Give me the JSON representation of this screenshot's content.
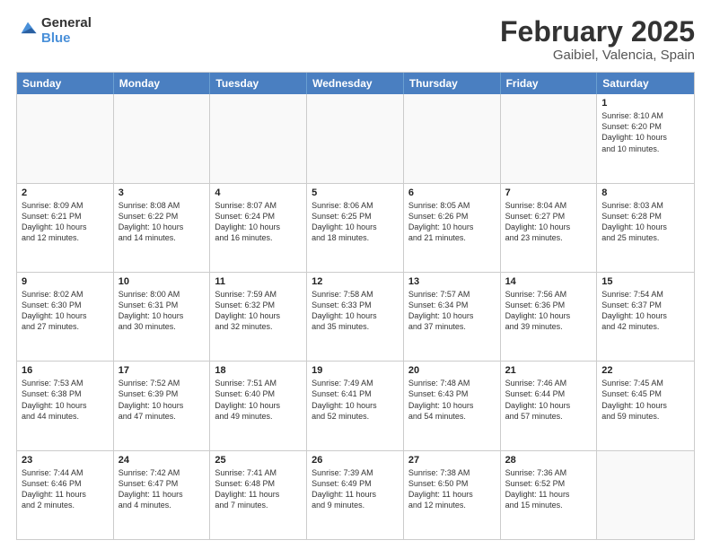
{
  "header": {
    "logo_general": "General",
    "logo_blue": "Blue",
    "month_title": "February 2025",
    "location": "Gaibiel, Valencia, Spain"
  },
  "weekdays": [
    "Sunday",
    "Monday",
    "Tuesday",
    "Wednesday",
    "Thursday",
    "Friday",
    "Saturday"
  ],
  "rows": [
    [
      {
        "day": "",
        "info": ""
      },
      {
        "day": "",
        "info": ""
      },
      {
        "day": "",
        "info": ""
      },
      {
        "day": "",
        "info": ""
      },
      {
        "day": "",
        "info": ""
      },
      {
        "day": "",
        "info": ""
      },
      {
        "day": "1",
        "info": "Sunrise: 8:10 AM\nSunset: 6:20 PM\nDaylight: 10 hours\nand 10 minutes."
      }
    ],
    [
      {
        "day": "2",
        "info": "Sunrise: 8:09 AM\nSunset: 6:21 PM\nDaylight: 10 hours\nand 12 minutes."
      },
      {
        "day": "3",
        "info": "Sunrise: 8:08 AM\nSunset: 6:22 PM\nDaylight: 10 hours\nand 14 minutes."
      },
      {
        "day": "4",
        "info": "Sunrise: 8:07 AM\nSunset: 6:24 PM\nDaylight: 10 hours\nand 16 minutes."
      },
      {
        "day": "5",
        "info": "Sunrise: 8:06 AM\nSunset: 6:25 PM\nDaylight: 10 hours\nand 18 minutes."
      },
      {
        "day": "6",
        "info": "Sunrise: 8:05 AM\nSunset: 6:26 PM\nDaylight: 10 hours\nand 21 minutes."
      },
      {
        "day": "7",
        "info": "Sunrise: 8:04 AM\nSunset: 6:27 PM\nDaylight: 10 hours\nand 23 minutes."
      },
      {
        "day": "8",
        "info": "Sunrise: 8:03 AM\nSunset: 6:28 PM\nDaylight: 10 hours\nand 25 minutes."
      }
    ],
    [
      {
        "day": "9",
        "info": "Sunrise: 8:02 AM\nSunset: 6:30 PM\nDaylight: 10 hours\nand 27 minutes."
      },
      {
        "day": "10",
        "info": "Sunrise: 8:00 AM\nSunset: 6:31 PM\nDaylight: 10 hours\nand 30 minutes."
      },
      {
        "day": "11",
        "info": "Sunrise: 7:59 AM\nSunset: 6:32 PM\nDaylight: 10 hours\nand 32 minutes."
      },
      {
        "day": "12",
        "info": "Sunrise: 7:58 AM\nSunset: 6:33 PM\nDaylight: 10 hours\nand 35 minutes."
      },
      {
        "day": "13",
        "info": "Sunrise: 7:57 AM\nSunset: 6:34 PM\nDaylight: 10 hours\nand 37 minutes."
      },
      {
        "day": "14",
        "info": "Sunrise: 7:56 AM\nSunset: 6:36 PM\nDaylight: 10 hours\nand 39 minutes."
      },
      {
        "day": "15",
        "info": "Sunrise: 7:54 AM\nSunset: 6:37 PM\nDaylight: 10 hours\nand 42 minutes."
      }
    ],
    [
      {
        "day": "16",
        "info": "Sunrise: 7:53 AM\nSunset: 6:38 PM\nDaylight: 10 hours\nand 44 minutes."
      },
      {
        "day": "17",
        "info": "Sunrise: 7:52 AM\nSunset: 6:39 PM\nDaylight: 10 hours\nand 47 minutes."
      },
      {
        "day": "18",
        "info": "Sunrise: 7:51 AM\nSunset: 6:40 PM\nDaylight: 10 hours\nand 49 minutes."
      },
      {
        "day": "19",
        "info": "Sunrise: 7:49 AM\nSunset: 6:41 PM\nDaylight: 10 hours\nand 52 minutes."
      },
      {
        "day": "20",
        "info": "Sunrise: 7:48 AM\nSunset: 6:43 PM\nDaylight: 10 hours\nand 54 minutes."
      },
      {
        "day": "21",
        "info": "Sunrise: 7:46 AM\nSunset: 6:44 PM\nDaylight: 10 hours\nand 57 minutes."
      },
      {
        "day": "22",
        "info": "Sunrise: 7:45 AM\nSunset: 6:45 PM\nDaylight: 10 hours\nand 59 minutes."
      }
    ],
    [
      {
        "day": "23",
        "info": "Sunrise: 7:44 AM\nSunset: 6:46 PM\nDaylight: 11 hours\nand 2 minutes."
      },
      {
        "day": "24",
        "info": "Sunrise: 7:42 AM\nSunset: 6:47 PM\nDaylight: 11 hours\nand 4 minutes."
      },
      {
        "day": "25",
        "info": "Sunrise: 7:41 AM\nSunset: 6:48 PM\nDaylight: 11 hours\nand 7 minutes."
      },
      {
        "day": "26",
        "info": "Sunrise: 7:39 AM\nSunset: 6:49 PM\nDaylight: 11 hours\nand 9 minutes."
      },
      {
        "day": "27",
        "info": "Sunrise: 7:38 AM\nSunset: 6:50 PM\nDaylight: 11 hours\nand 12 minutes."
      },
      {
        "day": "28",
        "info": "Sunrise: 7:36 AM\nSunset: 6:52 PM\nDaylight: 11 hours\nand 15 minutes."
      },
      {
        "day": "",
        "info": ""
      }
    ]
  ]
}
